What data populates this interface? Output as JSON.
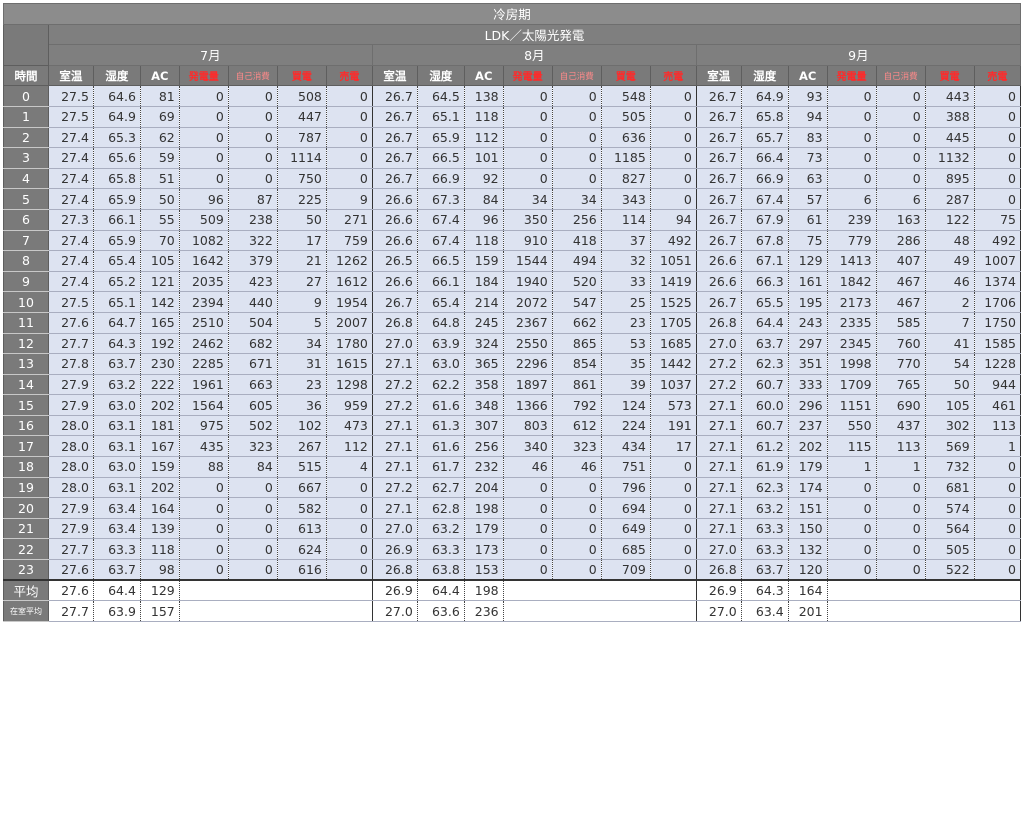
{
  "title": "冷房期",
  "subtitle": "LDK／太陽光発電",
  "months": [
    "7月",
    "8月",
    "9月"
  ],
  "row_header": "時間",
  "columns": [
    "室温",
    "湿度",
    "AC",
    "発電量",
    "自己消費",
    "買電",
    "売電"
  ],
  "rows": [
    {
      "hour": "0",
      "m": [
        [
          "27.5",
          "64.6",
          "81",
          "0",
          "0",
          "508",
          "0"
        ],
        [
          "26.7",
          "64.5",
          "138",
          "0",
          "0",
          "548",
          "0"
        ],
        [
          "26.7",
          "64.9",
          "93",
          "0",
          "0",
          "443",
          "0"
        ]
      ]
    },
    {
      "hour": "1",
      "m": [
        [
          "27.5",
          "64.9",
          "69",
          "0",
          "0",
          "447",
          "0"
        ],
        [
          "26.7",
          "65.1",
          "118",
          "0",
          "0",
          "505",
          "0"
        ],
        [
          "26.7",
          "65.8",
          "94",
          "0",
          "0",
          "388",
          "0"
        ]
      ]
    },
    {
      "hour": "2",
      "m": [
        [
          "27.4",
          "65.3",
          "62",
          "0",
          "0",
          "787",
          "0"
        ],
        [
          "26.7",
          "65.9",
          "112",
          "0",
          "0",
          "636",
          "0"
        ],
        [
          "26.7",
          "65.7",
          "83",
          "0",
          "0",
          "445",
          "0"
        ]
      ]
    },
    {
      "hour": "3",
      "m": [
        [
          "27.4",
          "65.6",
          "59",
          "0",
          "0",
          "1114",
          "0"
        ],
        [
          "26.7",
          "66.5",
          "101",
          "0",
          "0",
          "1185",
          "0"
        ],
        [
          "26.7",
          "66.4",
          "73",
          "0",
          "0",
          "1132",
          "0"
        ]
      ]
    },
    {
      "hour": "4",
      "m": [
        [
          "27.4",
          "65.8",
          "51",
          "0",
          "0",
          "750",
          "0"
        ],
        [
          "26.7",
          "66.9",
          "92",
          "0",
          "0",
          "827",
          "0"
        ],
        [
          "26.7",
          "66.9",
          "63",
          "0",
          "0",
          "895",
          "0"
        ]
      ]
    },
    {
      "hour": "5",
      "m": [
        [
          "27.4",
          "65.9",
          "50",
          "96",
          "87",
          "225",
          "9"
        ],
        [
          "26.6",
          "67.3",
          "84",
          "34",
          "34",
          "343",
          "0"
        ],
        [
          "26.7",
          "67.4",
          "57",
          "6",
          "6",
          "287",
          "0"
        ]
      ]
    },
    {
      "hour": "6",
      "m": [
        [
          "27.3",
          "66.1",
          "55",
          "509",
          "238",
          "50",
          "271"
        ],
        [
          "26.6",
          "67.4",
          "96",
          "350",
          "256",
          "114",
          "94"
        ],
        [
          "26.7",
          "67.9",
          "61",
          "239",
          "163",
          "122",
          "75"
        ]
      ]
    },
    {
      "hour": "7",
      "m": [
        [
          "27.4",
          "65.9",
          "70",
          "1082",
          "322",
          "17",
          "759"
        ],
        [
          "26.6",
          "67.4",
          "118",
          "910",
          "418",
          "37",
          "492"
        ],
        [
          "26.7",
          "67.8",
          "75",
          "779",
          "286",
          "48",
          "492"
        ]
      ]
    },
    {
      "hour": "8",
      "m": [
        [
          "27.4",
          "65.4",
          "105",
          "1642",
          "379",
          "21",
          "1262"
        ],
        [
          "26.5",
          "66.5",
          "159",
          "1544",
          "494",
          "32",
          "1051"
        ],
        [
          "26.6",
          "67.1",
          "129",
          "1413",
          "407",
          "49",
          "1007"
        ]
      ]
    },
    {
      "hour": "9",
      "m": [
        [
          "27.4",
          "65.2",
          "121",
          "2035",
          "423",
          "27",
          "1612"
        ],
        [
          "26.6",
          "66.1",
          "184",
          "1940",
          "520",
          "33",
          "1419"
        ],
        [
          "26.6",
          "66.3",
          "161",
          "1842",
          "467",
          "46",
          "1374"
        ]
      ]
    },
    {
      "hour": "10",
      "m": [
        [
          "27.5",
          "65.1",
          "142",
          "2394",
          "440",
          "9",
          "1954"
        ],
        [
          "26.7",
          "65.4",
          "214",
          "2072",
          "547",
          "25",
          "1525"
        ],
        [
          "26.7",
          "65.5",
          "195",
          "2173",
          "467",
          "2",
          "1706"
        ]
      ]
    },
    {
      "hour": "11",
      "m": [
        [
          "27.6",
          "64.7",
          "165",
          "2510",
          "504",
          "5",
          "2007"
        ],
        [
          "26.8",
          "64.8",
          "245",
          "2367",
          "662",
          "23",
          "1705"
        ],
        [
          "26.8",
          "64.4",
          "243",
          "2335",
          "585",
          "7",
          "1750"
        ]
      ]
    },
    {
      "hour": "12",
      "m": [
        [
          "27.7",
          "64.3",
          "192",
          "2462",
          "682",
          "34",
          "1780"
        ],
        [
          "27.0",
          "63.9",
          "324",
          "2550",
          "865",
          "53",
          "1685"
        ],
        [
          "27.0",
          "63.7",
          "297",
          "2345",
          "760",
          "41",
          "1585"
        ]
      ]
    },
    {
      "hour": "13",
      "m": [
        [
          "27.8",
          "63.7",
          "230",
          "2285",
          "671",
          "31",
          "1615"
        ],
        [
          "27.1",
          "63.0",
          "365",
          "2296",
          "854",
          "35",
          "1442"
        ],
        [
          "27.2",
          "62.3",
          "351",
          "1998",
          "770",
          "54",
          "1228"
        ]
      ]
    },
    {
      "hour": "14",
      "m": [
        [
          "27.9",
          "63.2",
          "222",
          "1961",
          "663",
          "23",
          "1298"
        ],
        [
          "27.2",
          "62.2",
          "358",
          "1897",
          "861",
          "39",
          "1037"
        ],
        [
          "27.2",
          "60.7",
          "333",
          "1709",
          "765",
          "50",
          "944"
        ]
      ]
    },
    {
      "hour": "15",
      "m": [
        [
          "27.9",
          "63.0",
          "202",
          "1564",
          "605",
          "36",
          "959"
        ],
        [
          "27.2",
          "61.6",
          "348",
          "1366",
          "792",
          "124",
          "573"
        ],
        [
          "27.1",
          "60.0",
          "296",
          "1151",
          "690",
          "105",
          "461"
        ]
      ]
    },
    {
      "hour": "16",
      "m": [
        [
          "28.0",
          "63.1",
          "181",
          "975",
          "502",
          "102",
          "473"
        ],
        [
          "27.1",
          "61.3",
          "307",
          "803",
          "612",
          "224",
          "191"
        ],
        [
          "27.1",
          "60.7",
          "237",
          "550",
          "437",
          "302",
          "113"
        ]
      ]
    },
    {
      "hour": "17",
      "m": [
        [
          "28.0",
          "63.1",
          "167",
          "435",
          "323",
          "267",
          "112"
        ],
        [
          "27.1",
          "61.6",
          "256",
          "340",
          "323",
          "434",
          "17"
        ],
        [
          "27.1",
          "61.2",
          "202",
          "115",
          "113",
          "569",
          "1"
        ]
      ]
    },
    {
      "hour": "18",
      "m": [
        [
          "28.0",
          "63.0",
          "159",
          "88",
          "84",
          "515",
          "4"
        ],
        [
          "27.1",
          "61.7",
          "232",
          "46",
          "46",
          "751",
          "0"
        ],
        [
          "27.1",
          "61.9",
          "179",
          "1",
          "1",
          "732",
          "0"
        ]
      ]
    },
    {
      "hour": "19",
      "m": [
        [
          "28.0",
          "63.1",
          "202",
          "0",
          "0",
          "667",
          "0"
        ],
        [
          "27.2",
          "62.7",
          "204",
          "0",
          "0",
          "796",
          "0"
        ],
        [
          "27.1",
          "62.3",
          "174",
          "0",
          "0",
          "681",
          "0"
        ]
      ]
    },
    {
      "hour": "20",
      "m": [
        [
          "27.9",
          "63.4",
          "164",
          "0",
          "0",
          "582",
          "0"
        ],
        [
          "27.1",
          "62.8",
          "198",
          "0",
          "0",
          "694",
          "0"
        ],
        [
          "27.1",
          "63.2",
          "151",
          "0",
          "0",
          "574",
          "0"
        ]
      ]
    },
    {
      "hour": "21",
      "m": [
        [
          "27.9",
          "63.4",
          "139",
          "0",
          "0",
          "613",
          "0"
        ],
        [
          "27.0",
          "63.2",
          "179",
          "0",
          "0",
          "649",
          "0"
        ],
        [
          "27.1",
          "63.3",
          "150",
          "0",
          "0",
          "564",
          "0"
        ]
      ]
    },
    {
      "hour": "22",
      "m": [
        [
          "27.7",
          "63.3",
          "118",
          "0",
          "0",
          "624",
          "0"
        ],
        [
          "26.9",
          "63.3",
          "173",
          "0",
          "0",
          "685",
          "0"
        ],
        [
          "27.0",
          "63.3",
          "132",
          "0",
          "0",
          "505",
          "0"
        ]
      ]
    },
    {
      "hour": "23",
      "m": [
        [
          "27.6",
          "63.7",
          "98",
          "0",
          "0",
          "616",
          "0"
        ],
        [
          "26.8",
          "63.8",
          "153",
          "0",
          "0",
          "709",
          "0"
        ],
        [
          "26.8",
          "63.7",
          "120",
          "0",
          "0",
          "522",
          "0"
        ]
      ]
    }
  ],
  "footer": [
    {
      "label": "平均",
      "m": [
        [
          "27.6",
          "64.4",
          "129"
        ],
        [
          "26.9",
          "64.4",
          "198"
        ],
        [
          "26.9",
          "64.3",
          "164"
        ]
      ]
    },
    {
      "label": "在室平均",
      "m": [
        [
          "27.7",
          "63.9",
          "157"
        ],
        [
          "27.0",
          "63.6",
          "236"
        ],
        [
          "27.0",
          "63.4",
          "201"
        ]
      ]
    }
  ]
}
